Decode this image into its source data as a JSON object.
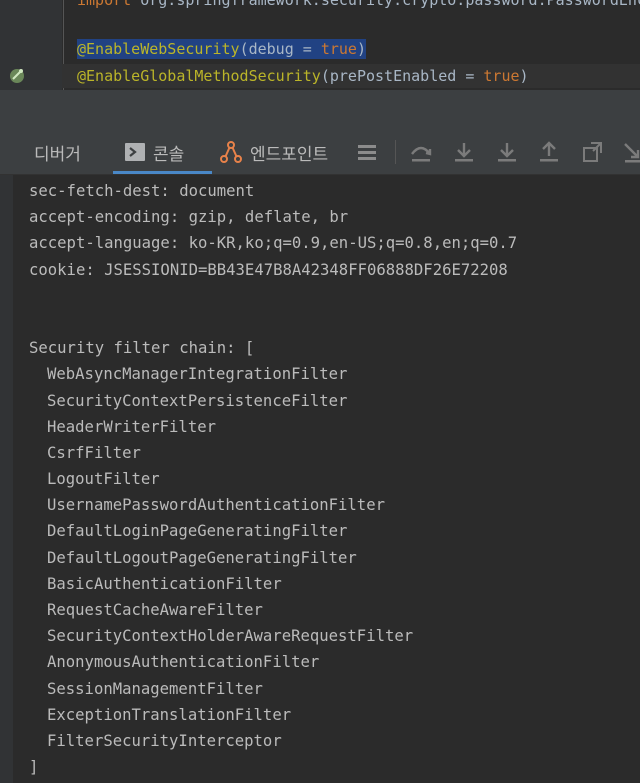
{
  "editor": {
    "line0_keyword": "import",
    "line0_rest": " org.springframework.security.crypto.password.PasswordEncoder;",
    "line1_annotation": "@EnableWebSecurity",
    "line1_open": "(debug = ",
    "line1_value": "true",
    "line1_close": ")",
    "line2_annotation": "@EnableGlobalMethodSecurity",
    "line2_open": "(prePostEnabled = ",
    "line2_value": "true",
    "line2_close": ")"
  },
  "tabs": {
    "debugger": "디버거",
    "console": "콘솔",
    "endpoints": "엔드포인트"
  },
  "toolbar_icons": [
    "menu-icon",
    "step-over-icon",
    "step-into-icon",
    "force-step-into-icon",
    "step-out-icon",
    "drop-frame-icon",
    "run-to-cursor-icon"
  ],
  "console": {
    "header_lines": [
      "sec-fetch-dest: document",
      "accept-encoding: gzip, deflate, br",
      "accept-language: ko-KR,ko;q=0.9,en-US;q=0.8,en;q=0.7",
      "cookie: JSESSIONID=BB43E47B8A42348FF06888DF26E72208"
    ],
    "chain_title": "Security filter chain: [",
    "filters": [
      "WebAsyncManagerIntegrationFilter",
      "SecurityContextPersistenceFilter",
      "HeaderWriterFilter",
      "CsrfFilter",
      "LogoutFilter",
      "UsernamePasswordAuthenticationFilter",
      "DefaultLoginPageGeneratingFilter",
      "DefaultLogoutPageGeneratingFilter",
      "BasicAuthenticationFilter",
      "RequestCacheAwareFilter",
      "SecurityContextHolderAwareRequestFilter",
      "AnonymousAuthenticationFilter",
      "SessionManagementFilter",
      "ExceptionTranslationFilter",
      "FilterSecurityInterceptor"
    ],
    "chain_close": "]"
  }
}
